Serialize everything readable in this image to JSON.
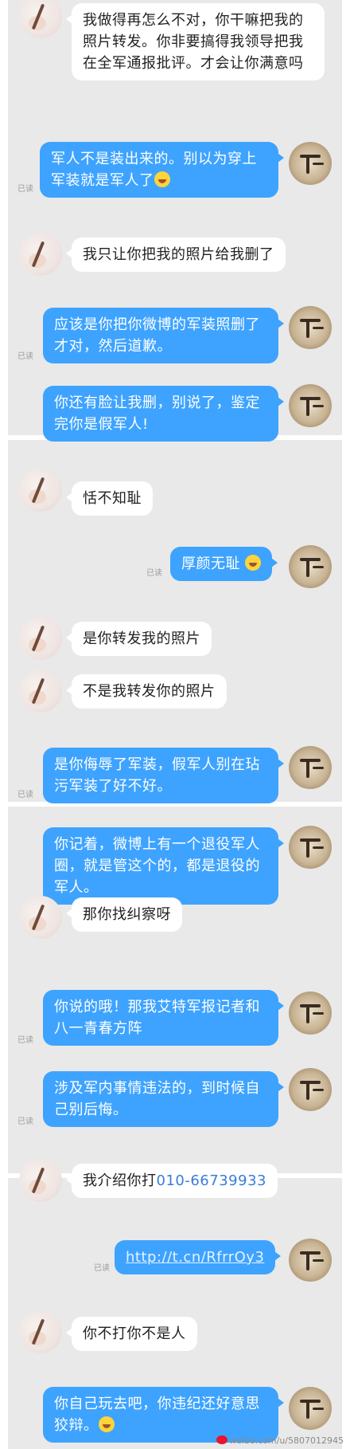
{
  "read_label": "已读",
  "messages": [
    {
      "text": "我做得再怎么不对，你干嘛把我的照片转发。你非要搞得我领导把我在全军通报批评。才会让你满意吗"
    },
    {
      "text": "军人不是装出来的。别以为穿上军装就是军人了",
      "emoji": "grin-emoji"
    },
    {
      "text": "我只让你把我的照片给我删了"
    },
    {
      "text": "应该是你把你微博的军装照删了才对，然后道歉。"
    },
    {
      "text": "你还有脸让我删，别说了，鉴定完你是假军人!"
    },
    {
      "text": "恬不知耻"
    },
    {
      "text": "厚颜无耻",
      "emoji": "smirk-emoji"
    },
    {
      "text": "是你转发我的照片"
    },
    {
      "text": "不是我转发你的照片"
    },
    {
      "text": "是你侮辱了军装，假军人别在玷污军装了好不好。"
    },
    {
      "text": "你记着，微博上有一个退役军人圈，就是管这个的，都是退役的军人。"
    },
    {
      "text": "那你找纠察呀"
    },
    {
      "text": "你说的哦！那我艾特军报记者和八一青春方阵"
    },
    {
      "text": "涉及军内事情违法的，到时候自己别后悔。"
    },
    {
      "text": "我介绍你打",
      "phone": "010-66739933"
    },
    {
      "link": "http://t.cn/RfrrOy3"
    },
    {
      "text": "你不打你不是人"
    },
    {
      "text": "你自己玩去吧，你违纪还好意思狡辩。",
      "emoji": "grimace-emoji"
    }
  ],
  "watermark": "weibo.com/u/5807012945"
}
